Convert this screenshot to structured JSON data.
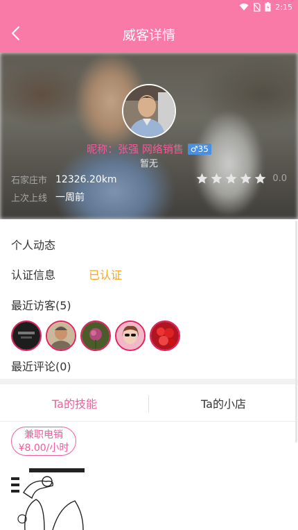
{
  "status_bar": {
    "time": "2:15"
  },
  "header": {
    "title": "威客详情"
  },
  "profile": {
    "nickname": "昵称：张强 网络销售",
    "gender_badge": "♂35",
    "signature": "暂无",
    "city_label": "石家庄市",
    "distance": "12326.20km",
    "last_online_label": "上次上线",
    "last_online_value": "一周前",
    "rating": {
      "filled_stars": 0,
      "total_stars": 5,
      "value_text": "0.0"
    }
  },
  "sections": {
    "personal_feed": "个人动态",
    "verification_label": "认证信息",
    "verification_status": "已认证",
    "recent_visitors": "最近访客(5)",
    "recent_comments": "最近评论(0)"
  },
  "tabs": [
    {
      "label": "Ta的技能",
      "active": true
    },
    {
      "label": "Ta的小店",
      "active": false
    }
  ],
  "skill": {
    "name": "兼职电销",
    "price": "¥8.00/小时"
  },
  "colors": {
    "brand_pink": "#f979a7",
    "accent_pink": "#f25c9a",
    "verified_orange": "#f5a623",
    "gender_blue": "#4a90e2"
  }
}
